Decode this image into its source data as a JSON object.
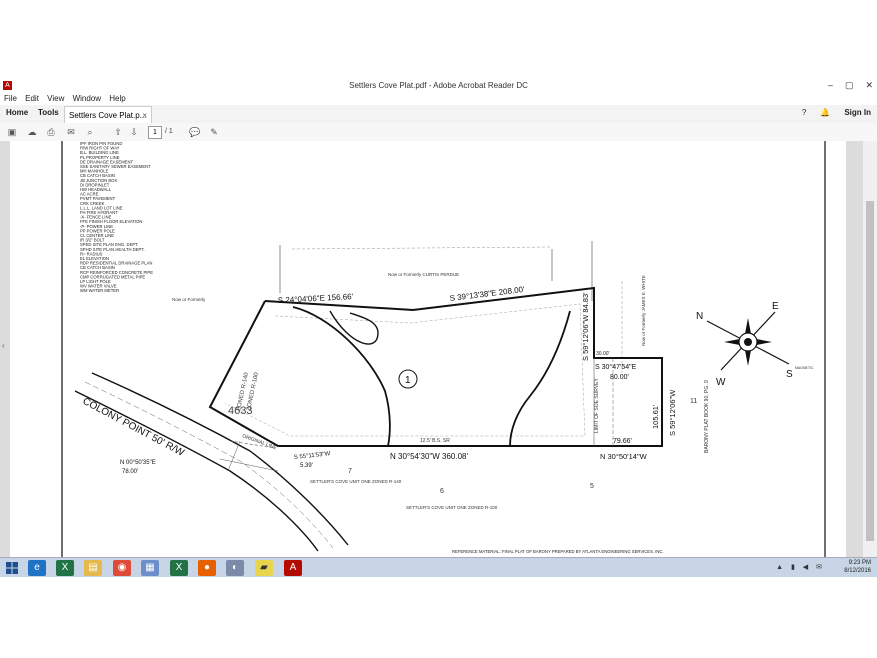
{
  "window": {
    "title": "Settlers Cove Plat.pdf - Adobe Acrobat Reader DC",
    "app_icon": "acrobat-icon"
  },
  "menu": [
    "File",
    "Edit",
    "View",
    "Window",
    "Help"
  ],
  "nav": {
    "home": "Home",
    "tools": "Tools",
    "sign_in": "Sign In"
  },
  "document_tab": {
    "label": "Settlers Cove Plat.p...",
    "close": "×"
  },
  "toolbar": {
    "page_current": "1",
    "page_total": "/ 1"
  },
  "plat": {
    "legend": [
      "IPF IRON PIN FOUND",
      "R/W RIGHT OF WAY",
      "B.L. BUILDING LINE",
      "PL PROPERTY LINE",
      "DE DRAINAGE EASEMENT",
      "SSE SANITARY SEWER EASEMENT",
      "MH MANHOLE",
      "CB CATCH BASIN",
      "JB JUNCTION BOX",
      "DI DROPINLET",
      "HW HEADWALL",
      "AC ACRE",
      "PVMT PAVEMENT",
      "CRK CREEK",
      "L.L.L. LAND LOT LINE",
      "FH FIRE HYDRANT",
      "-X- FENCE LINE",
      "FFE FINISH FLOOR ELEVATION",
      "-P- POWER LINE",
      "PP POWER POLE",
      "CL CENTER LINE",
      "IR 3/2\" BOLT",
      "SPED SITE PLAN ENG. DEPT.",
      "SPHD SITE PLAN HEALTH DEPT.",
      "R= RADIUS",
      "EL ELEVATION",
      "RDP RESIDENTIAL DRAINAGE PLAN",
      "CB CATCH BASIN",
      "RCP REINFORCED CONCRETE PIPE",
      "CMP CORRUGATED METAL PIPE",
      "LP LIGHT POLE",
      "WV WATER VALVE",
      "WM WATER METER"
    ],
    "bearings": {
      "north_a": "S 24°04'06\"E 156.66'",
      "north_b": "S 39°13'38\"E 208.00'",
      "east_a": "S 59°12'06\"W 84.83'",
      "east_inner": "S 30°47'54\"E",
      "east_inner_dist": "80.00'",
      "east_b": "S 59°12'06\"W",
      "east_b_dist": "105.61'",
      "south": "N 30°54'30\"W 360.08'",
      "south_east": "N 30°50'14\"W",
      "south_east_dist": "79.66'",
      "west": "S 55°11'53\"W",
      "west_dist": "5.39'",
      "front": "N 00°50'35\"E",
      "front_dist": "78.00'"
    },
    "lot_number": "1",
    "labels": {
      "road": "COLONY POINT 50' R/W",
      "lot_code": "4633",
      "zoned_1": "ZONED R-140",
      "zoned_2": "ZONED R-100",
      "soe": "LIMIT OF SOE SURVEY",
      "original_line": "ORIGINAL LINE",
      "north_neighbor": "Now or Formerly CURTIS PERDUE",
      "east_neighbor": "Now or Formerly JAMES E. WHITE",
      "west_neighbor": "Now or Formerly",
      "barony": "BARONY PLAT BOOK 90, PG. 9",
      "lot_7": "7",
      "lot_6": "6",
      "lot_5": "5",
      "lot_11": "11",
      "settlers_cove_1": "SETTLER'S COVE UNIT ONE ZONED R-140",
      "settlers_cove_2": "SETTLER'S COVE UNIT ONE ZONED R-100",
      "reference": "REFERENCE MATERIAL: FINAL PLAT OF BARONY PREPARED BY ATLANTA ENGINEERING SERVICES, INC.",
      "setback": "30.00'",
      "stream_buffer": "12.5' B.S. SR"
    },
    "north_arrow": {
      "n": "N",
      "e": "E",
      "s": "S",
      "w": "W",
      "magnetic": "MAGNETIC"
    }
  },
  "taskbar": {
    "start_icon": "windows-icon",
    "apps": [
      "ie-icon",
      "excel-icon",
      "explorer-icon",
      "chrome-icon",
      "paint-icon",
      "excel-icon",
      "firefox-icon",
      "tool-icon",
      "notes-icon",
      "acrobat-icon"
    ],
    "time": "9:23 PM",
    "date": "8/12/2016"
  }
}
